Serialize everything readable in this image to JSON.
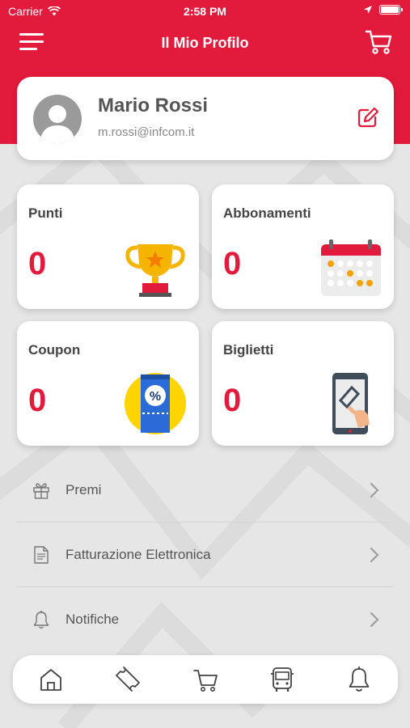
{
  "status_bar": {
    "carrier": "Carrier",
    "time": "2:58 PM"
  },
  "nav": {
    "title": "Il Mio Profilo"
  },
  "profile": {
    "name": "Mario Rossi",
    "email": "m.rossi@infcom.it"
  },
  "tiles": [
    {
      "title": "Punti",
      "value": "0",
      "icon": "trophy-icon"
    },
    {
      "title": "Abbonamenti",
      "value": "0",
      "icon": "calendar-icon"
    },
    {
      "title": "Coupon",
      "value": "0",
      "icon": "coupon-icon"
    },
    {
      "title": "Biglietti",
      "value": "0",
      "icon": "mobile-ticket-icon"
    }
  ],
  "menu": [
    {
      "label": "Premi",
      "icon": "gift-icon"
    },
    {
      "label": "Fatturazione Elettronica",
      "icon": "document-icon"
    },
    {
      "label": "Notifiche",
      "icon": "bell-icon"
    }
  ],
  "tabbar": [
    "home-icon",
    "ticket-icon",
    "cart-icon",
    "bus-icon",
    "bell-icon"
  ],
  "colors": {
    "accent": "#e21a3b",
    "background": "#e6e6e6",
    "card": "#ffffff"
  }
}
